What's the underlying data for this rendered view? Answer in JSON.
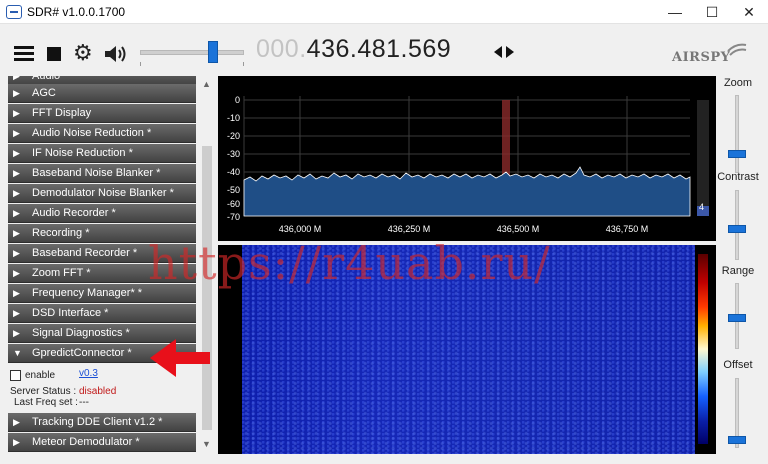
{
  "window": {
    "title": "SDR# v1.0.0.1700",
    "minimize": "—",
    "maximize": "☐",
    "close": "✕"
  },
  "toolbar": {
    "frequency_dim": "000.",
    "frequency_main": "436.481.569",
    "logo_text": "AIRSPY"
  },
  "plugins_top": [
    {
      "label": "Audio"
    },
    {
      "label": "AGC"
    },
    {
      "label": "FFT Display"
    },
    {
      "label": "Audio Noise Reduction *"
    },
    {
      "label": "IF Noise Reduction *"
    },
    {
      "label": "Baseband Noise Blanker *"
    },
    {
      "label": "Demodulator Noise Blanker *"
    },
    {
      "label": "Audio Recorder *"
    },
    {
      "label": "Recording *"
    },
    {
      "label": "Baseband Recorder *"
    },
    {
      "label": "Zoom FFT *"
    },
    {
      "label": "Frequency Manager* *"
    },
    {
      "label": "DSD Interface *"
    },
    {
      "label": "Signal Diagnostics *"
    }
  ],
  "expanded_plugin": {
    "label": "GpredictConnector *",
    "enable_label": "enable",
    "version_link": "v0.3",
    "server_status_label": "Server Status :",
    "server_status_value": "disabled",
    "last_freq_label": "Last Freq set :",
    "last_freq_value": "---"
  },
  "plugins_bottom": [
    {
      "label": "Tracking DDE Client v1.2 *"
    },
    {
      "label": "Meteor Demodulator *"
    }
  ],
  "spectrum": {
    "y_ticks": [
      "0",
      "-10",
      "-20",
      "-30",
      "-40",
      "-50",
      "-60",
      "-70"
    ],
    "x_ticks": [
      "436,000 M",
      "436,250 M",
      "436,500 M",
      "436,750 M"
    ],
    "smeter_value": "4"
  },
  "right_controls": {
    "zoom_label": "Zoom",
    "contrast_label": "Contrast",
    "range_label": "Range",
    "offset_label": "Offset"
  },
  "overlay": {
    "watermark": "https://r4uab.ru/"
  },
  "colors": {
    "plugin_header": "#4f4f4f",
    "accent_blue": "#1a73d9",
    "status_red": "#c01818",
    "waterfall_blue": "#1627b9",
    "arrow_red": "#e8101a"
  }
}
